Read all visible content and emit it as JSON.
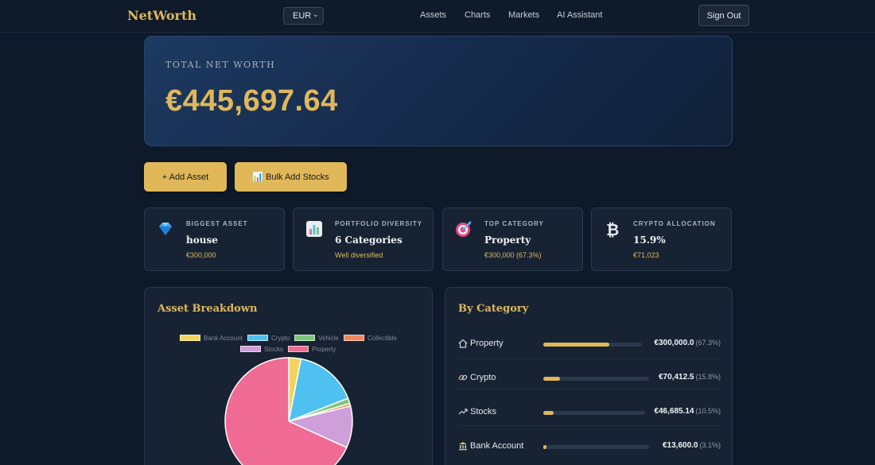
{
  "header": {
    "brand": "NetWorth",
    "currency": "EUR",
    "nav": [
      "Assets",
      "Charts",
      "Markets",
      "AI Assistant"
    ],
    "sign_out": "Sign Out"
  },
  "hero": {
    "label": "TOTAL NET WORTH",
    "value": "€445,697.64"
  },
  "actions": {
    "add_asset": "+ Add Asset",
    "bulk_add": "📊 Bulk Add Stocks"
  },
  "cards": [
    {
      "label": "BIGGEST ASSET",
      "value": "house",
      "sub": "€300,000",
      "icon": "diamond-icon"
    },
    {
      "label": "PORTFOLIO DIVERSITY",
      "value": "6 Categories",
      "sub": "Well diversified",
      "icon": "chart-icon"
    },
    {
      "label": "TOP CATEGORY",
      "value": "Property",
      "sub": "€300,000 (67.3%)",
      "icon": "target-icon"
    },
    {
      "label": "CRYPTO ALLOCATION",
      "value": "15.9%",
      "sub": "€71,023",
      "icon": "bitcoin-icon"
    }
  ],
  "breakdown": {
    "title": "Asset Breakdown"
  },
  "category": {
    "title": "By Category",
    "rows": [
      {
        "name": "Property",
        "amount": "€300,000.0",
        "pct": "(67.3%)",
        "icon": "home-icon"
      },
      {
        "name": "Crypto",
        "amount": "€70,412.5",
        "pct": "(15.8%)",
        "icon": "link-icon"
      },
      {
        "name": "Stocks",
        "amount": "€46,685.14",
        "pct": "(10.5%)",
        "icon": "trend-icon"
      },
      {
        "name": "Bank Account",
        "amount": "€13,600.0",
        "pct": "(3.1%)",
        "icon": "bank-icon"
      }
    ],
    "fractions": [
      0.673,
      0.158,
      0.105,
      0.031
    ]
  },
  "chart_data": {
    "type": "pie",
    "categories": [
      "Bank Account",
      "Crypto",
      "Vehicle",
      "Collectible",
      "Stocks",
      "Property"
    ],
    "values": [
      13600,
      70412.5,
      6000,
      3000,
      46685.14,
      300000
    ],
    "colors": [
      "#f2d45c",
      "#4fc1f0",
      "#7fc67d",
      "#f1875c",
      "#cf9fd9",
      "#f06b93"
    ],
    "legend": "top"
  },
  "colors": {
    "accent": "#e0b85a",
    "background": "#0e1a29",
    "card": "#172333"
  }
}
